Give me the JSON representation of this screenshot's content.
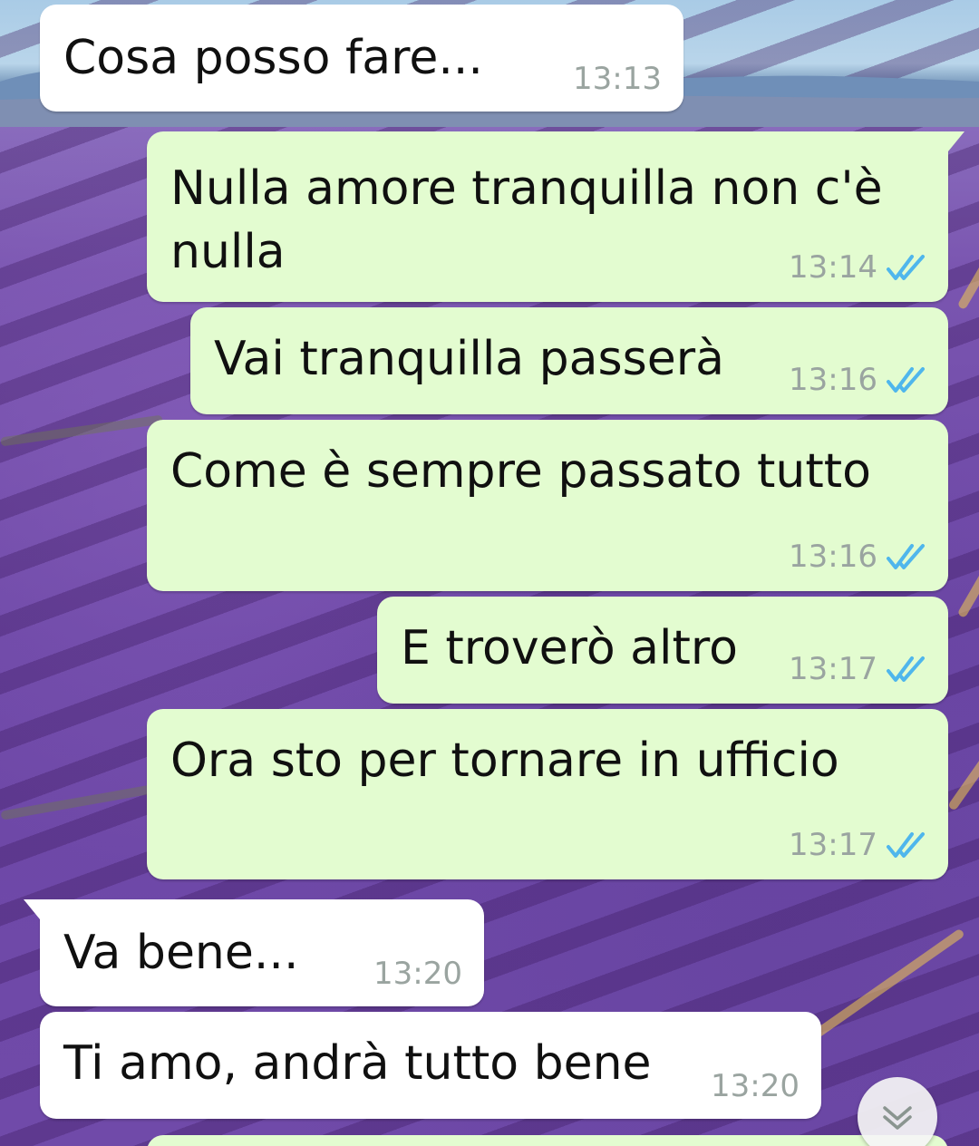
{
  "colors": {
    "incoming_bubble": "#ffffff",
    "outgoing_bubble": "#e3fcd0",
    "read_tick": "#4fb6ec",
    "timestamp": "#9aa4a0"
  },
  "messages": [
    {
      "direction": "incoming",
      "text": "Cosa posso fare...",
      "time": "13:13"
    },
    {
      "direction": "outgoing",
      "text": "Nulla amore tranquilla non c'è\nnulla",
      "time": "13:14",
      "status_icon": "double-check-read-icon"
    },
    {
      "direction": "outgoing",
      "text": "Vai tranquilla passerà",
      "time": "13:16",
      "status_icon": "double-check-read-icon"
    },
    {
      "direction": "outgoing",
      "text": "Come è sempre passato tutto",
      "time": "13:16",
      "status_icon": "double-check-read-icon"
    },
    {
      "direction": "outgoing",
      "text": "E troverò altro",
      "time": "13:17",
      "status_icon": "double-check-read-icon"
    },
    {
      "direction": "outgoing",
      "text": "Ora sto per tornare in ufficio",
      "time": "13:17",
      "status_icon": "double-check-read-icon"
    },
    {
      "direction": "incoming",
      "text": "Va bene...",
      "time": "13:20"
    },
    {
      "direction": "incoming",
      "text": "Ti amo, andrà tutto bene",
      "time": "13:20"
    }
  ],
  "scroll_button_icon": "chevron-double-down-icon",
  "wallpaper": "lavender-field"
}
